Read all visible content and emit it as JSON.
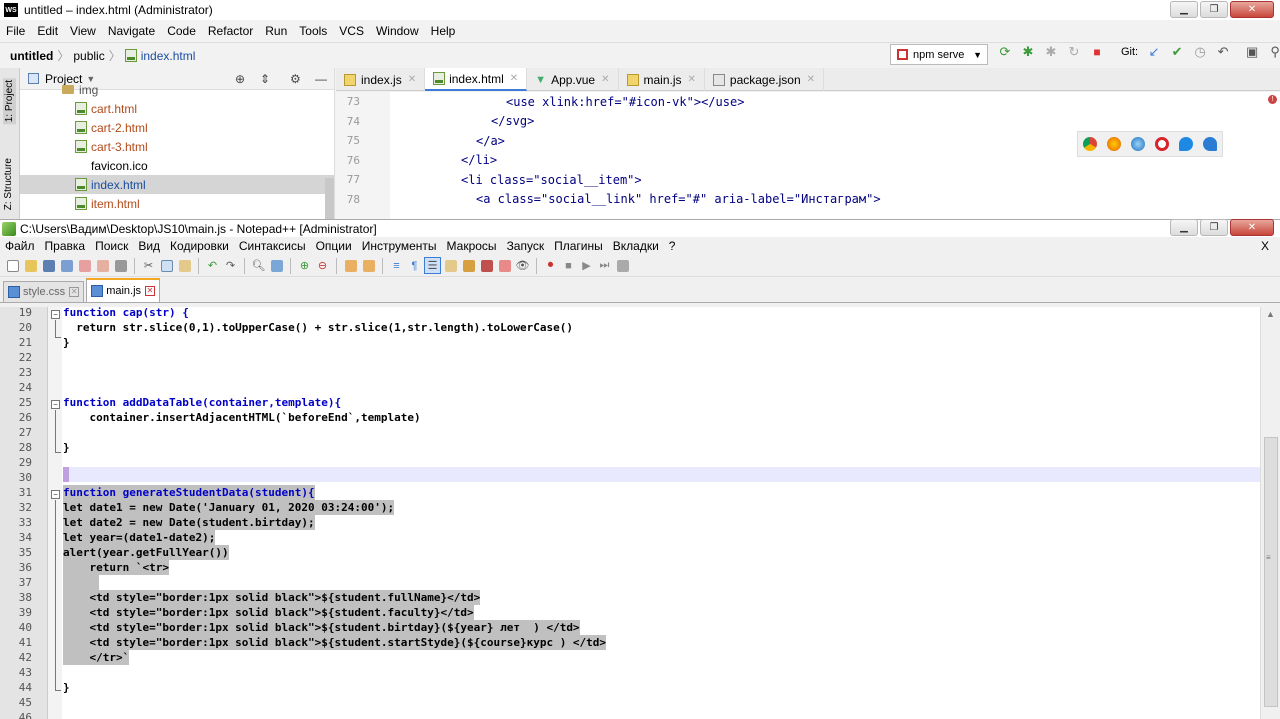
{
  "webstorm": {
    "title": "untitled – index.html (Administrator)",
    "logo": "WS",
    "menu": [
      "File",
      "Edit",
      "View",
      "Navigate",
      "Code",
      "Refactor",
      "Run",
      "Tools",
      "VCS",
      "Window",
      "Help"
    ],
    "breadcrumb": {
      "project": "untitled",
      "folder": "public",
      "file": "index.html"
    },
    "run_config": "npm serve",
    "git_label": "Git:",
    "side_tabs": {
      "project": "1: Project",
      "structure": "Z: Structure"
    },
    "project_panel": {
      "title": "Project",
      "items": [
        {
          "name": "img",
          "type": "folder"
        },
        {
          "name": "cart.html",
          "type": "html"
        },
        {
          "name": "cart-2.html",
          "type": "html"
        },
        {
          "name": "cart-3.html",
          "type": "html"
        },
        {
          "name": "favicon.ico",
          "type": "plain"
        },
        {
          "name": "index.html",
          "type": "html",
          "selected": true
        },
        {
          "name": "item.html",
          "type": "html"
        }
      ]
    },
    "tabs": [
      {
        "label": "index.js",
        "active": false
      },
      {
        "label": "index.html",
        "active": true
      },
      {
        "label": "App.vue",
        "active": false
      },
      {
        "label": "main.js",
        "active": false
      },
      {
        "label": "package.json",
        "active": false
      }
    ],
    "lines": [
      {
        "n": "73",
        "code": "<use xlink:href=\"#icon-vk\"></use>"
      },
      {
        "n": "74",
        "code": "</svg>"
      },
      {
        "n": "75",
        "code": "</a>"
      },
      {
        "n": "76",
        "code": "</li>"
      },
      {
        "n": "77",
        "code": "<li class=\"social__item\">"
      },
      {
        "n": "78",
        "code": "<a class=\"social__link\" href=\"#\" aria-label=\"Инстаграм\">"
      }
    ]
  },
  "notepad": {
    "title": "C:\\Users\\Вадим\\Desktop\\JS10\\main.js - Notepad++ [Administrator]",
    "menu": [
      "Файл",
      "Правка",
      "Поиск",
      "Вид",
      "Кодировки",
      "Синтаксисы",
      "Опции",
      "Инструменты",
      "Макросы",
      "Запуск",
      "Плагины",
      "Вкладки",
      "?"
    ],
    "menu_close": "X",
    "tabs": [
      {
        "label": "style.css",
        "active": false
      },
      {
        "label": "main.js",
        "active": true
      }
    ],
    "lines": [
      {
        "n": "19",
        "code": "function cap(str) {"
      },
      {
        "n": "20",
        "code": "  return str.slice(0,1).toUpperCase() + str.slice(1,str.length).toLowerCase()"
      },
      {
        "n": "21",
        "code": "}"
      },
      {
        "n": "22",
        "code": ""
      },
      {
        "n": "23",
        "code": ""
      },
      {
        "n": "24",
        "code": ""
      },
      {
        "n": "25",
        "code": "function addDataTable(container,template){"
      },
      {
        "n": "26",
        "code": "    container.insertAdjacentHTML(`beforeEnd`,template)"
      },
      {
        "n": "27",
        "code": ""
      },
      {
        "n": "28",
        "code": "}"
      },
      {
        "n": "29",
        "code": ""
      },
      {
        "n": "30",
        "code": ""
      },
      {
        "n": "31",
        "code": "function generateStudentData(student){"
      },
      {
        "n": "32",
        "code": "let date1 = new Date('January 01, 2020 03:24:00');"
      },
      {
        "n": "33",
        "code": "let date2 = new Date(student.birtday);"
      },
      {
        "n": "34",
        "code": "let year=(date1-date2);"
      },
      {
        "n": "35",
        "code": "alert(year.getFullYear())"
      },
      {
        "n": "36",
        "code": "    return `<tr>"
      },
      {
        "n": "37",
        "code": ""
      },
      {
        "n": "38",
        "code": "    <td style=\"border:1px solid black\">${student.fullName}</td>"
      },
      {
        "n": "39",
        "code": "    <td style=\"border:1px solid black\">${student.faculty}</td>"
      },
      {
        "n": "40",
        "code": "    <td style=\"border:1px solid black\">${student.birtday}(${year} лет  ) </td>"
      },
      {
        "n": "41",
        "code": "    <td style=\"border:1px solid black\">${student.startStyde}(${course}курс ) </td>"
      },
      {
        "n": "42",
        "code": "    </tr>`"
      },
      {
        "n": "43",
        "code": ""
      },
      {
        "n": "44",
        "code": "}"
      },
      {
        "n": "45",
        "code": ""
      },
      {
        "n": "46",
        "code": ""
      }
    ]
  }
}
